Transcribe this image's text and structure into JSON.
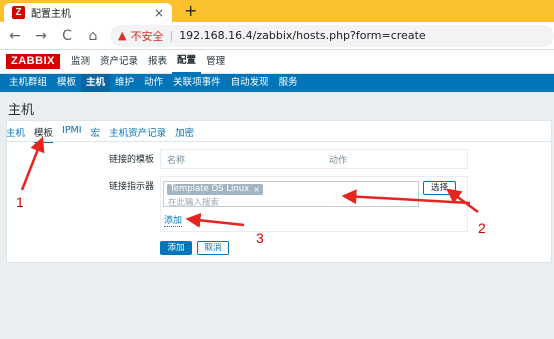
{
  "browser": {
    "tab_title": "配置主机",
    "favicon_letter": "Z",
    "tab_close": "×",
    "new_tab": "+",
    "back": "←",
    "forward": "→",
    "reload": "C",
    "home": "⌂",
    "insecure_label": "不安全",
    "separator": "|",
    "url": "192.168.16.4/zabbix/hosts.php?form=create"
  },
  "header": {
    "logo": "ZABBIX",
    "menu": [
      "监测",
      "资产记录",
      "报表",
      "配置",
      "管理"
    ],
    "active_menu": "配置"
  },
  "submenu": {
    "items": [
      "主机群组",
      "模板",
      "主机",
      "维护",
      "动作",
      "关联项事件",
      "自动发现",
      "服务"
    ],
    "active": "主机"
  },
  "page": {
    "title": "主机"
  },
  "form_tabs": {
    "items": [
      "主机",
      "模板",
      "IPMI",
      "宏",
      "主机资产记录",
      "加密"
    ],
    "active": "模板"
  },
  "form": {
    "linked_templates_label": "链接的模板",
    "linked_col_name": "名称",
    "linked_col_action": "动作",
    "link_indicator_label": "链接指示器",
    "chip_label": "Template OS Linux",
    "chip_remove": "×",
    "search_placeholder": "在此输入搜索",
    "select_button": "选择",
    "add_link": "添加",
    "submit_button": "添加",
    "cancel_button": "取消"
  },
  "annotations": {
    "num1": "1",
    "num2": "2",
    "num3": "3"
  },
  "colors": {
    "tabstrip": "#fbc02d",
    "zabbix_red": "#d40000",
    "zabbix_blue": "#0275b8",
    "annotation_red": "#e8241f"
  }
}
